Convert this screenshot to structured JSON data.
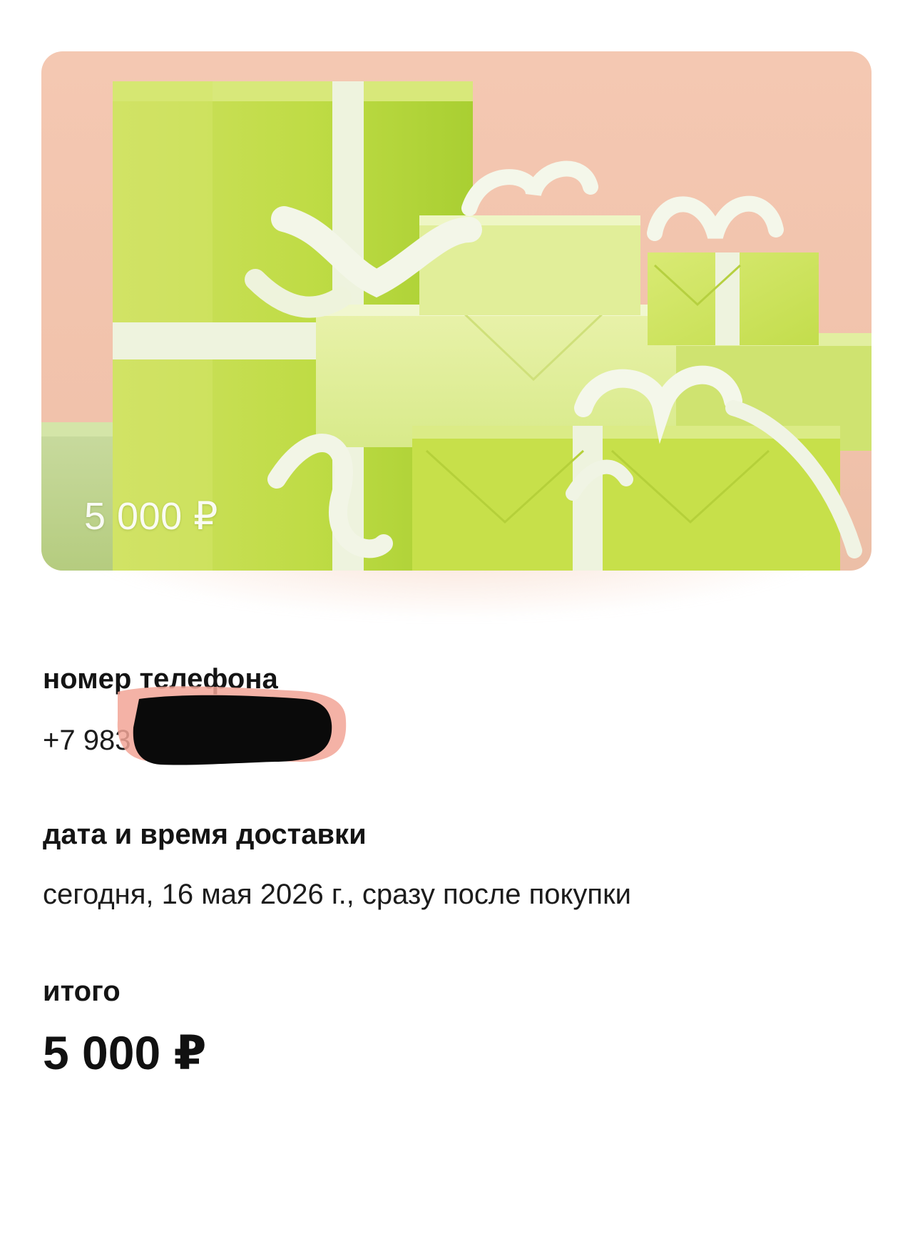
{
  "gift_card": {
    "amount": "5 000 ₽",
    "background_color": "#f4c8b2",
    "box_color": "#c8df55",
    "ribbon_color": "#f4f7ea"
  },
  "phone": {
    "label": "номер телефона",
    "value": "+7 983"
  },
  "delivery": {
    "label": "дата и время доставки",
    "value": "сегодня, 16 мая 2026 г., сразу после покупки"
  },
  "total": {
    "label": "итого",
    "value": "5 000 ₽"
  }
}
